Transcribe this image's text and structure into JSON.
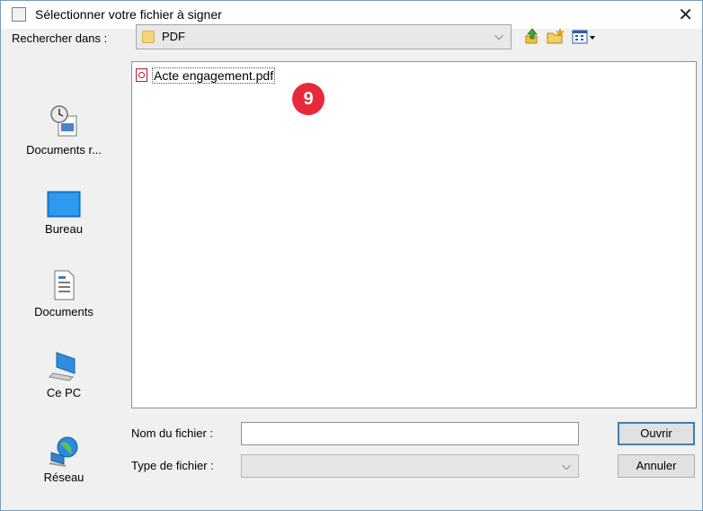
{
  "dialog": {
    "title": "Sélectionner votre fichier à signer",
    "close_glyph": "✕"
  },
  "lookin": {
    "label": "Rechercher dans :",
    "value": "PDF",
    "chevron": "⌵"
  },
  "toolbar": {
    "icons": [
      "up-one-level-icon",
      "new-folder-icon",
      "view-menu-icon"
    ]
  },
  "sidebar": {
    "items": [
      {
        "label": "Documents r...",
        "icon": "recent-documents-icon"
      },
      {
        "label": "Bureau",
        "icon": "desktop-icon"
      },
      {
        "label": "Documents",
        "icon": "documents-icon"
      },
      {
        "label": "Ce PC",
        "icon": "computer-icon"
      },
      {
        "label": "Réseau",
        "icon": "network-icon"
      }
    ]
  },
  "files": [
    {
      "name": "Acte engagement.pdf",
      "icon": "pdf-file-icon"
    }
  ],
  "annotation": {
    "step": "9",
    "color": "#e8293b"
  },
  "form": {
    "filename_label": "Nom du fichier :",
    "filename_value": "",
    "filetype_label": "Type de fichier :",
    "filetype_value": "",
    "chevron": "⌵"
  },
  "buttons": {
    "open": "Ouvrir",
    "cancel": "Annuler"
  },
  "colors": {
    "accent": "#3c7fb1",
    "dialog_bg": "#f0f0f0"
  }
}
